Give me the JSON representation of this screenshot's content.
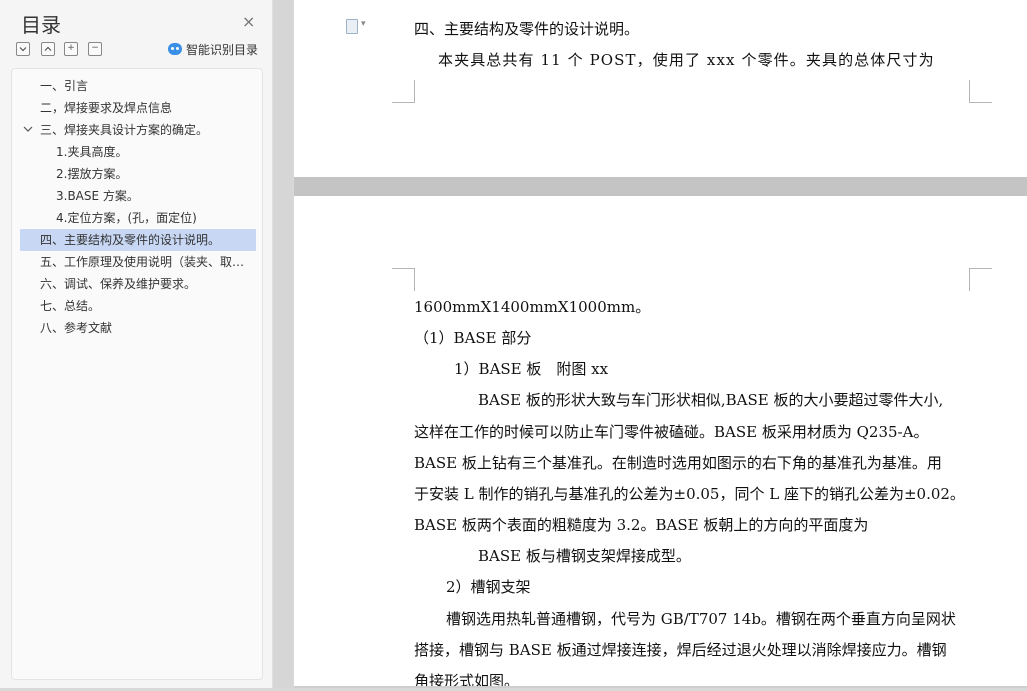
{
  "sidebar": {
    "title": "目录",
    "close_glyph": "×",
    "tools": {
      "collapse": "−",
      "up": "⌃",
      "expand": "+",
      "minus": "−"
    },
    "smart_label": "智能识别目录",
    "items": [
      {
        "label": "一、引言"
      },
      {
        "label": "二，焊接要求及焊点信息"
      },
      {
        "label": "三、焊接夹具设计方案的确定。"
      },
      {
        "label": "1.夹具高度。"
      },
      {
        "label": "2.摆放方案。"
      },
      {
        "label": "3.BASE 方案。"
      },
      {
        "label": "4.定位方案，(孔，面定位)"
      },
      {
        "label": "四、主要结构及零件的设计说明。"
      },
      {
        "label": "五、工作原理及使用说明（装夹、取件方式）"
      },
      {
        "label": "六、调试、保养及维护要求。"
      },
      {
        "label": "七、总结。"
      },
      {
        "label": "八、参考文献"
      }
    ]
  },
  "doc": {
    "page1": {
      "heading": "四、主要结构及零件的设计说明。",
      "para": "本夹具总共有 11 个 POST，使用了 xxx 个零件。夹具的总体尺寸为"
    },
    "page2": {
      "lines": [
        "1600mmX1400mmX1000mm。",
        "（1）BASE 部分",
        "1）BASE 板　附图 xx",
        "BASE 板的形状大致与车门形状相似,BASE 板的大小要超过零件大小,",
        "这样在工作的时候可以防止车门零件被磕碰。BASE 板采用材质为 Q235-A。",
        "BASE 板上钻有三个基准孔。在制造时选用如图示的右下角的基准孔为基准。用",
        "于安装 L 制作的销孔与基准孔的公差为±0.05，同个 L 座下的销孔公差为±0.02。",
        "BASE 板两个表面的粗糙度为 3.2。BASE 板朝上的方向的平面度为",
        "BASE 板与槽钢支架焊接成型。",
        "2）槽钢支架",
        "槽钢选用热轧普通槽钢，代号为 GB/T707 14b。槽钢在两个垂直方向呈网状",
        "搭接，槽钢与 BASE 板通过焊接连接，焊后经过退火处理以消除焊接应力。槽钢",
        "角接形式如图。"
      ]
    }
  }
}
